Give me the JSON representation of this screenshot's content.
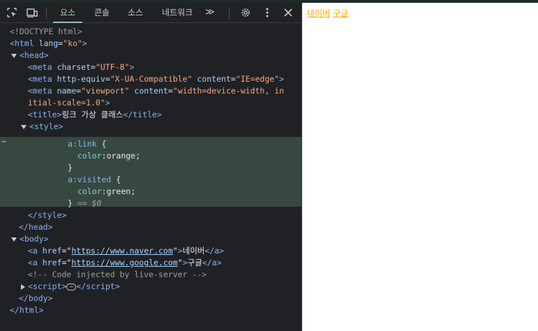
{
  "toolbar": {
    "tabs": [
      "요소",
      "콘솔",
      "소스",
      "네트워크"
    ],
    "more_symbol": "≫"
  },
  "code": {
    "doctype": "<!DOCTYPE html>",
    "html_open_tag": "html",
    "html_lang_attr": "lang",
    "html_lang_val": "\"ko\"",
    "head_tag": "head",
    "meta1_attr": "charset",
    "meta1_val": "\"UTF-8\"",
    "meta2_attr1": "http-equiv",
    "meta2_val1": "\"X-UA-Compatible\"",
    "meta2_attr2": "content",
    "meta2_val2": "\"IE=edge\"",
    "meta3_attr1": "name",
    "meta3_val1": "\"viewport\"",
    "meta3_attr2": "content",
    "meta3_val2a": "\"width=device-width, in",
    "meta3_val2b": "itial-scale=1.0\"",
    "title_text": "링크 가상 클래스",
    "style_tag": "style",
    "css_sel1_a": "a",
    "css_sel1_pseudo": ":link",
    "css_prop1": "color",
    "css_val1": "orange",
    "css_sel2_a": "a",
    "css_sel2_pseudo": ":visited",
    "css_prop2": "color",
    "css_val2": "green",
    "eq_marker": "== $0",
    "body_tag": "body",
    "link1_href": "https://www.naver.com",
    "link1_text": "네이버",
    "link2_href": "https://www.google.com",
    "link2_text": "구글",
    "comment": "<!-- Code injected by live-server -->",
    "script_tag": "script"
  },
  "page": {
    "link1": "네이버",
    "link2": "구글"
  }
}
